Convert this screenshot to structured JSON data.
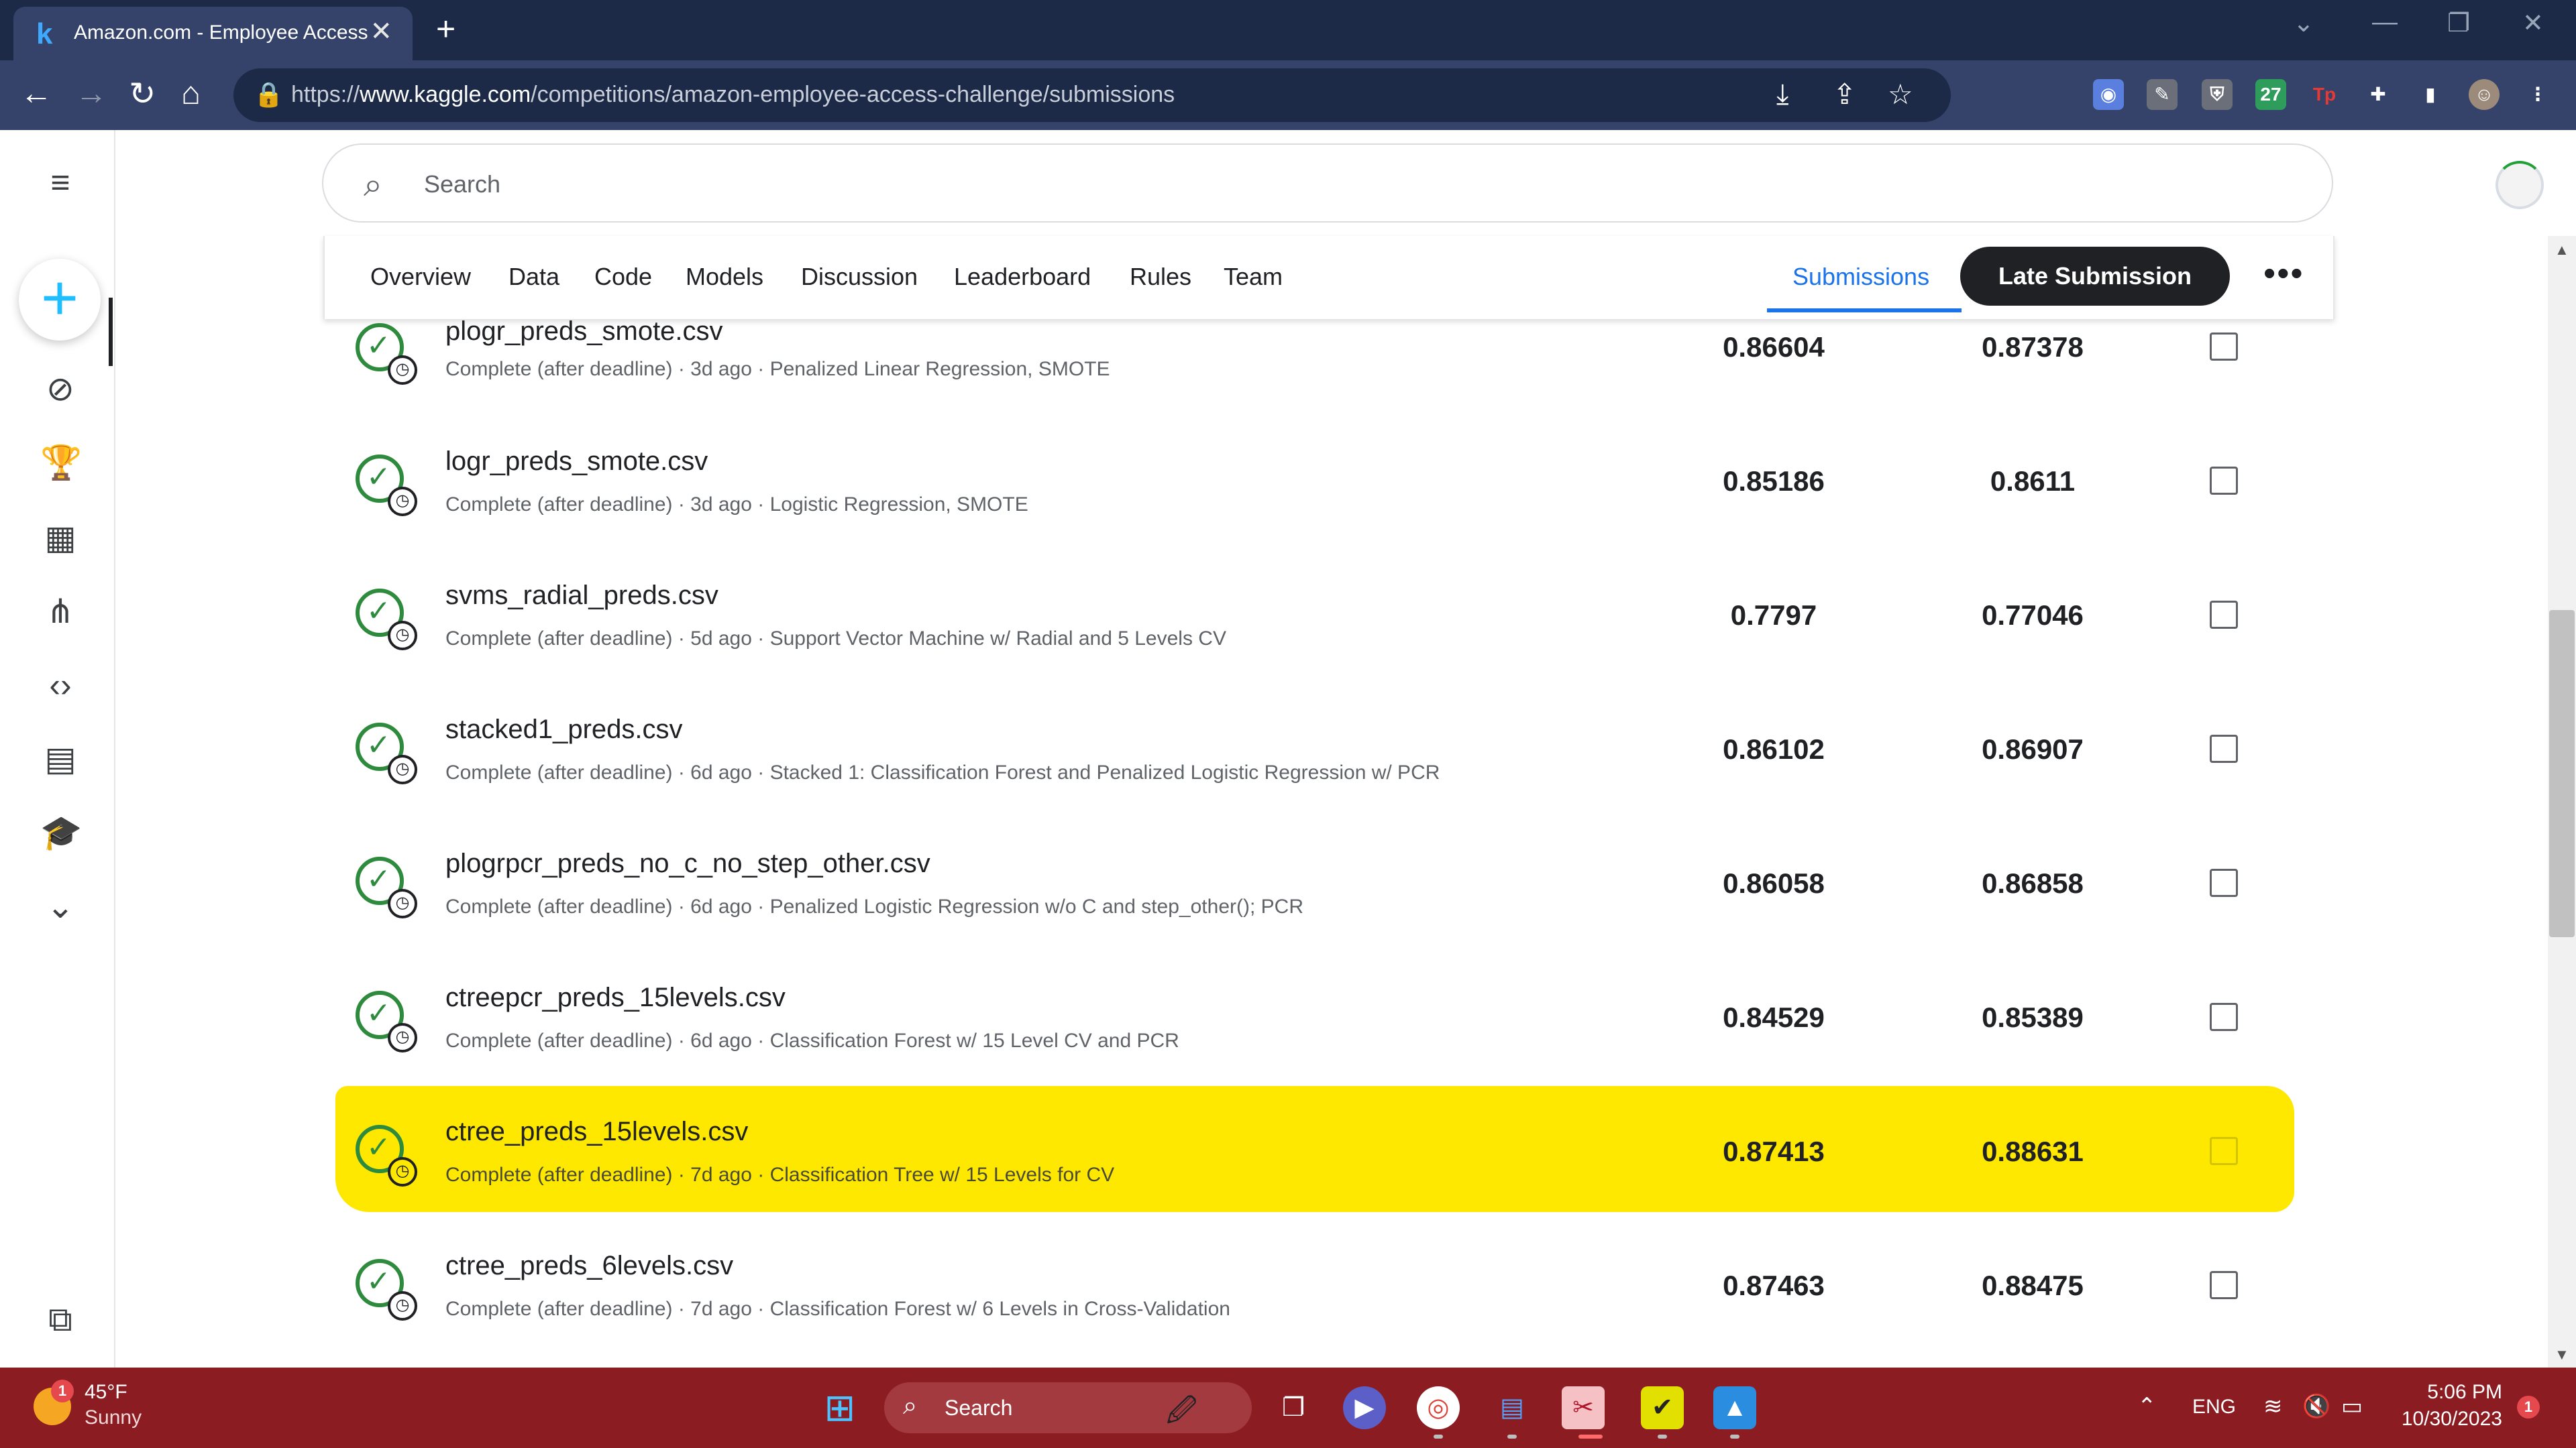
{
  "browser": {
    "tab_title": "Amazon.com - Employee Access Challenge",
    "favicon": "k",
    "url_scheme": "https://",
    "url_host": "www.kaggle.com",
    "url_path": "/competitions/amazon-employee-access-challenge/submissions"
  },
  "search": {
    "placeholder": "Search"
  },
  "tabs": [
    "Overview",
    "Data",
    "Code",
    "Models",
    "Discussion",
    "Leaderboard",
    "Rules",
    "Team"
  ],
  "active_tab": "Submissions",
  "late_submission_label": "Late Submission",
  "submissions": [
    {
      "file": "plogr_preds_smote.csv",
      "meta": "Complete (after deadline) · 3d ago · Penalized Linear Regression, SMOTE",
      "private": "0.86604",
      "public": "0.87378"
    },
    {
      "file": "logr_preds_smote.csv",
      "meta": "Complete (after deadline) · 3d ago · Logistic Regression, SMOTE",
      "private": "0.85186",
      "public": "0.8611"
    },
    {
      "file": "svms_radial_preds.csv",
      "meta": "Complete (after deadline) · 5d ago · Support Vector Machine w/ Radial and 5 Levels CV",
      "private": "0.7797",
      "public": "0.77046"
    },
    {
      "file": "stacked1_preds.csv",
      "meta": "Complete (after deadline) · 6d ago · Stacked 1: Classification Forest and Penalized Logistic Regression w/ PCR",
      "private": "0.86102",
      "public": "0.86907"
    },
    {
      "file": "plogrpcr_preds_no_c_no_step_other.csv",
      "meta": "Complete (after deadline) · 6d ago · Penalized Logistic Regression w/o C and step_other(); PCR",
      "private": "0.86058",
      "public": "0.86858"
    },
    {
      "file": "ctreepcr_preds_15levels.csv",
      "meta": "Complete (after deadline) · 6d ago · Classification Forest w/ 15 Level CV and PCR",
      "private": "0.84529",
      "public": "0.85389"
    },
    {
      "file": "ctree_preds_15levels.csv",
      "meta": "Complete (after deadline) · 7d ago · Classification Tree w/ 15 Levels for CV",
      "private": "0.87413",
      "public": "0.88631"
    },
    {
      "file": "ctree_preds_6levels.csv",
      "meta": "Complete (after deadline) · 7d ago · Classification Forest w/ 6 Levels in Cross-Validation",
      "private": "0.87463",
      "public": "0.88475"
    }
  ],
  "taskbar": {
    "weather_temp": "45°F",
    "weather_desc": "Sunny",
    "weather_badge": "1",
    "search_label": "Search",
    "language": "ENG",
    "time": "5:06 PM",
    "date": "10/30/2023",
    "notification_count": "1"
  },
  "colors": {
    "highlight": "#ffe800",
    "kaggle_blue": "#20beff",
    "taskbar": "#8b1c22",
    "success_green": "#2e8b3d"
  }
}
